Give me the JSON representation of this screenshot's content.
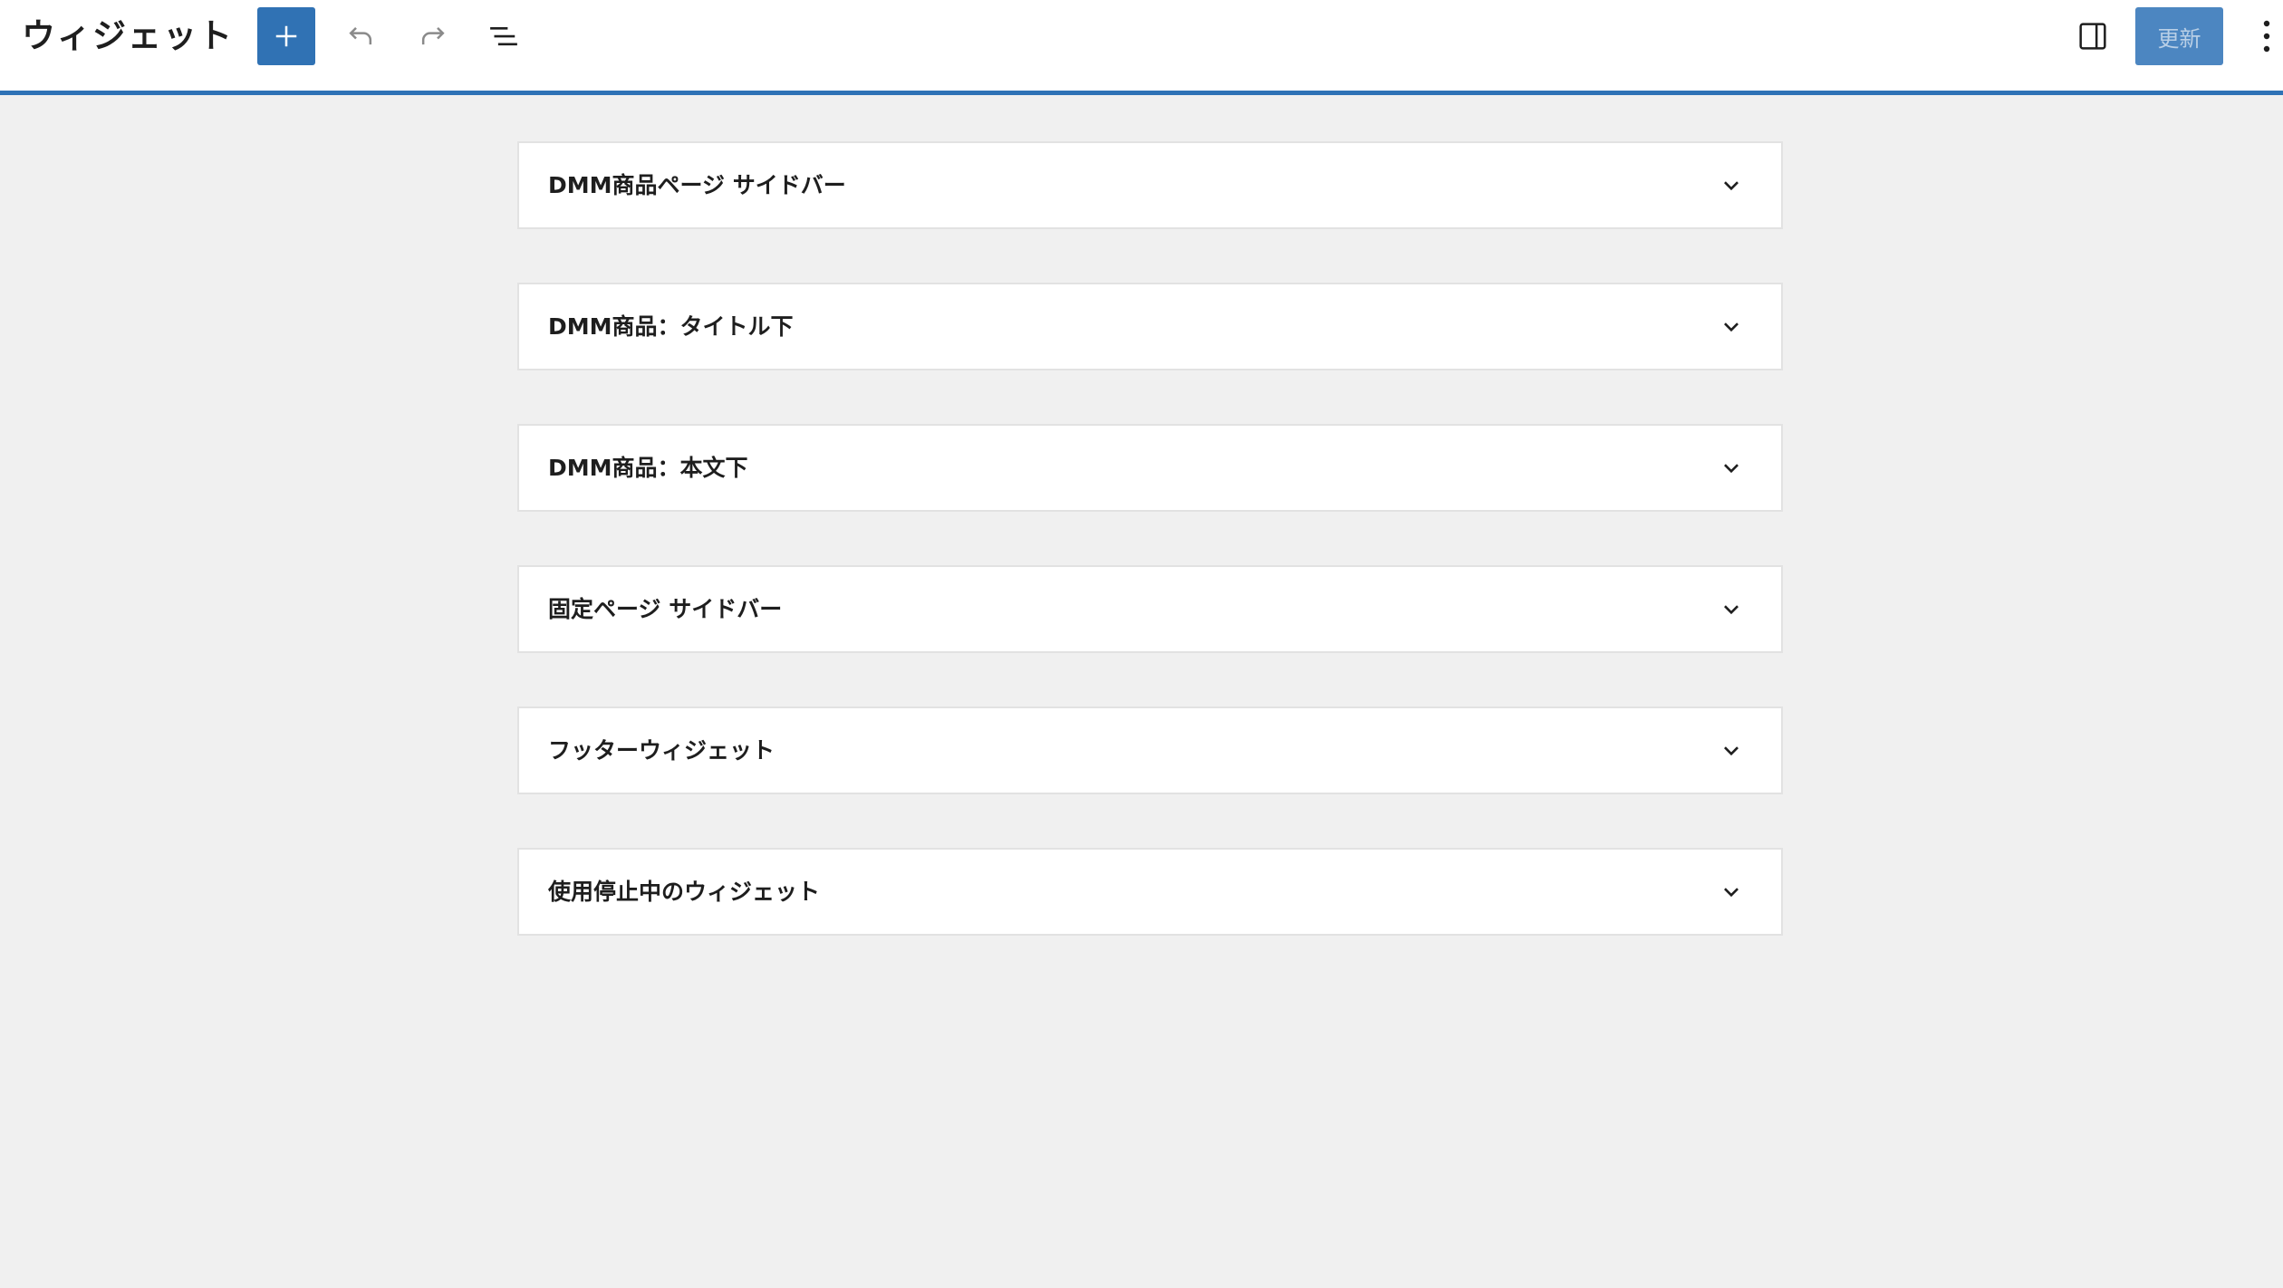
{
  "header": {
    "title": "ウィジェット",
    "update_label": "更新",
    "icons": {
      "add": "plus-icon",
      "undo": "undo-icon",
      "redo": "redo-icon",
      "list_view": "list-view-icon",
      "settings": "sidebar-toggle-icon",
      "options": "more-vertical-icon"
    }
  },
  "widget_areas": [
    {
      "title": "DMM商品ページ サイドバー"
    },
    {
      "title": "DMM商品：タイトル下"
    },
    {
      "title": "DMM商品：本文下"
    },
    {
      "title": "固定ページ サイドバー"
    },
    {
      "title": "フッターウィジェット"
    },
    {
      "title": "使用停止中のウィジェット"
    }
  ],
  "colors": {
    "accent": "#3072b4",
    "header_border": "#2e72b6",
    "background": "#f0f0f0"
  }
}
